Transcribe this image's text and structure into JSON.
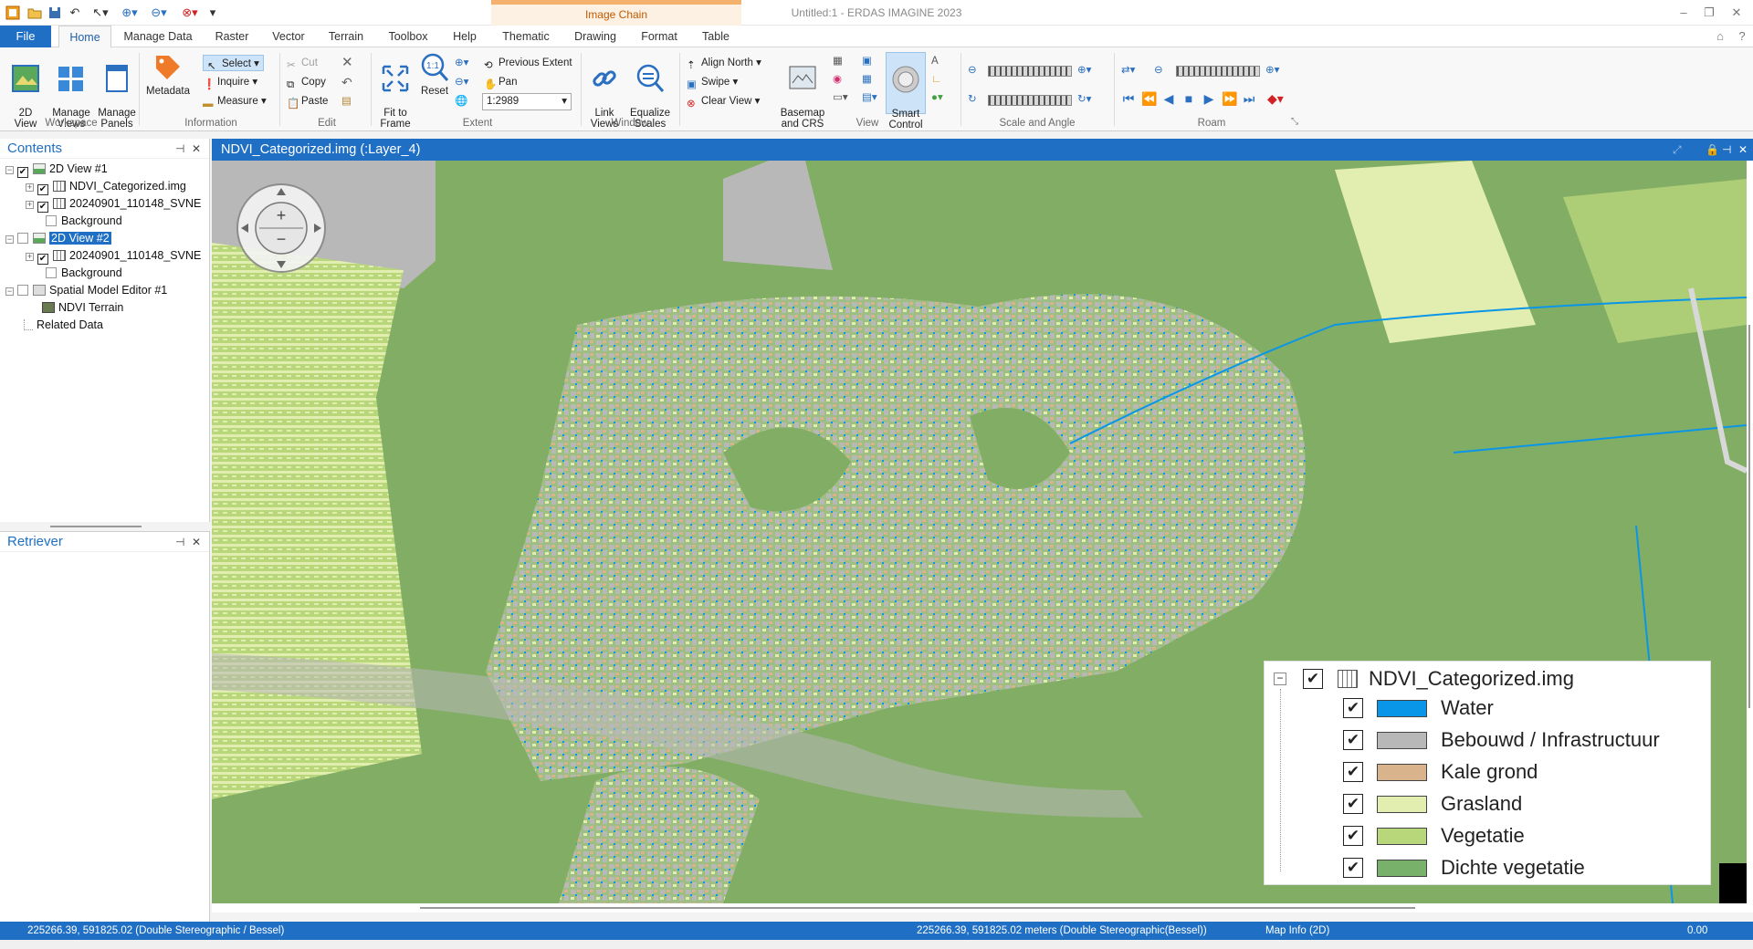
{
  "window": {
    "title": "Untitled:1 - ERDAS IMAGINE 2023",
    "context_tab": "Image Chain"
  },
  "ribbon_tabs": [
    "File",
    "Home",
    "Manage Data",
    "Raster",
    "Vector",
    "Terrain",
    "Toolbox",
    "Help",
    "Thematic",
    "Drawing",
    "Format",
    "Table"
  ],
  "ribbon": {
    "workspace": {
      "label": "Workspace",
      "view2d": "2D\nView",
      "manage_views": "Manage\nViews",
      "manage_panels": "Manage\nPanels"
    },
    "information": {
      "label": "Information",
      "metadata": "Metadata",
      "select": "Select",
      "inquire": "Inquire",
      "measure": "Measure"
    },
    "edit": {
      "label": "Edit",
      "cut": "Cut",
      "copy": "Copy",
      "paste": "Paste"
    },
    "extent": {
      "label": "Extent",
      "fit_to_frame": "Fit to\nFrame",
      "reset": "Reset",
      "previous_extent": "Previous Extent",
      "pan": "Pan",
      "scale": "1:2989"
    },
    "window": {
      "label": "Window",
      "link_views": "Link\nViews",
      "equalize_scales": "Equalize\nScales",
      "align_north": "Align North",
      "swipe": "Swipe",
      "clear_view": "Clear View"
    },
    "view": {
      "label": "View",
      "basemap": "Basemap\nand CRS",
      "smart_control": "Smart\nControl"
    },
    "scale_angle": {
      "label": "Scale and Angle"
    },
    "roam": {
      "label": "Roam"
    }
  },
  "contents": {
    "title": "Contents",
    "items": [
      {
        "label": "2D View #1",
        "checked": true
      },
      {
        "label": "NDVI_Categorized.img",
        "checked": true
      },
      {
        "label": "20240901_110148_SVNE",
        "checked": true
      },
      {
        "label": "Background",
        "checked": false
      },
      {
        "label": "2D View #2",
        "checked": false
      },
      {
        "label": "20240901_110148_SVNE",
        "checked": true
      },
      {
        "label": "Background",
        "checked": false
      },
      {
        "label": "Spatial Model Editor #1",
        "checked": false
      },
      {
        "label": "NDVI Terrain"
      },
      {
        "label": "Related Data"
      }
    ]
  },
  "retriever": {
    "title": "Retriever"
  },
  "view": {
    "title": "NDVI_Categorized.img (:Layer_4)"
  },
  "legend": {
    "title": "NDVI_Categorized.img",
    "classes": [
      {
        "label": "Water",
        "color": "#0a96e8"
      },
      {
        "label": "Bebouwd / Infrastructuur",
        "color": "#b8b8b8"
      },
      {
        "label": "Kale grond",
        "color": "#d8b38c"
      },
      {
        "label": "Grasland",
        "color": "#e2eeb0"
      },
      {
        "label": "Vegetatie",
        "color": "#b8d67a"
      },
      {
        "label": "Dichte vegetatie",
        "color": "#78b26a"
      }
    ]
  },
  "status": {
    "left": "225266.39, 591825.02  (Double Stereographic / Bessel)",
    "center": "225266.39, 591825.02 meters (Double Stereographic(Bessel))",
    "mapinfo": "Map Info (2D)",
    "right": "0.00"
  },
  "colors": {
    "accent": "#1f6fc4",
    "map_dense": "#82ad65",
    "map_built": "#b8b8b8"
  }
}
